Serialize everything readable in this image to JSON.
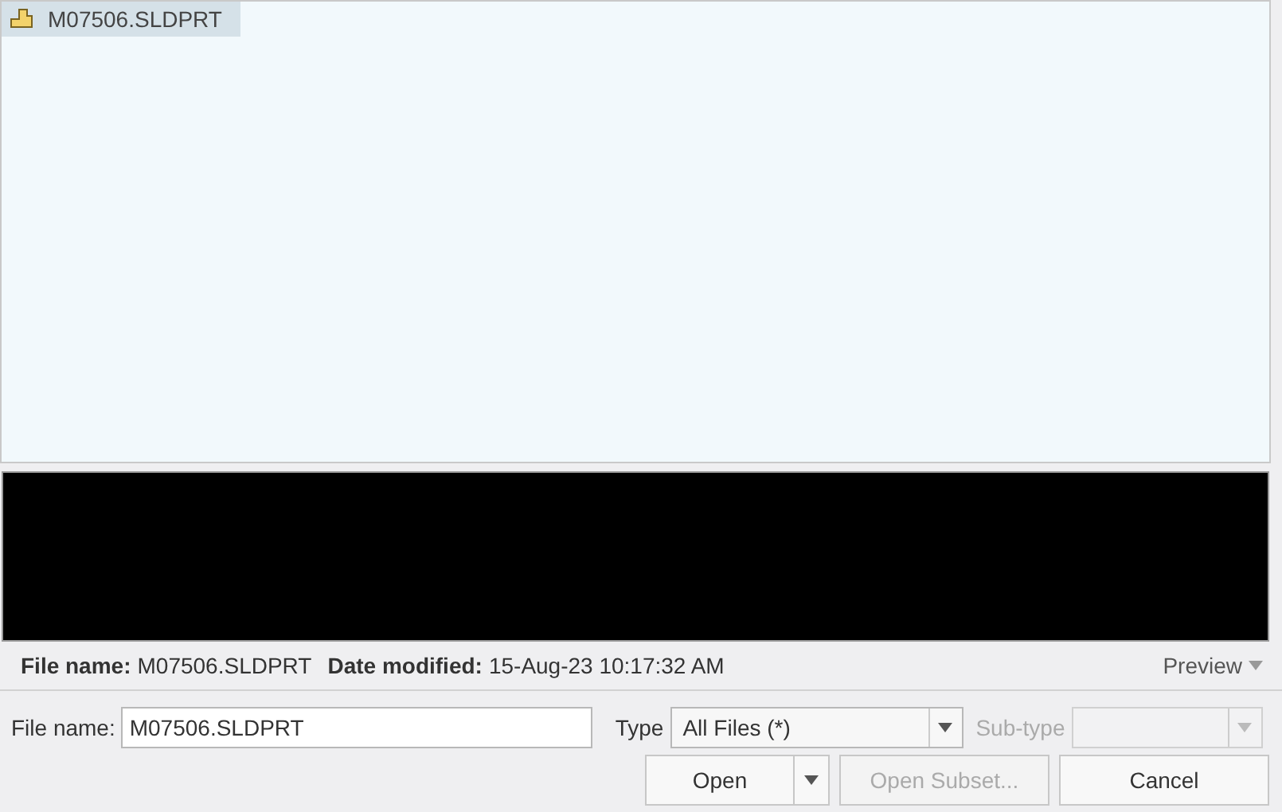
{
  "files": [
    {
      "name": "M07506.SLDPRT",
      "selected": true
    }
  ],
  "info": {
    "file_name_label": "File name:",
    "file_name": "M07506.SLDPRT",
    "date_label": "Date modified:",
    "date": "15-Aug-23 10:17:32 AM",
    "preview": "Preview"
  },
  "file_name_field": {
    "label": "File name:",
    "value": "M07506.SLDPRT"
  },
  "type_field": {
    "label": "Type",
    "value": "All Files (*)",
    "disabled": false
  },
  "subtype_field": {
    "label": "Sub-type",
    "disabled": true
  },
  "buttons": [
    {
      "label": "Open",
      "kind": "split",
      "disabled": false
    },
    {
      "label": "Open Subset...",
      "kind": "plain",
      "disabled": true
    },
    {
      "label": "Cancel",
      "kind": "plain",
      "disabled": false
    }
  ]
}
